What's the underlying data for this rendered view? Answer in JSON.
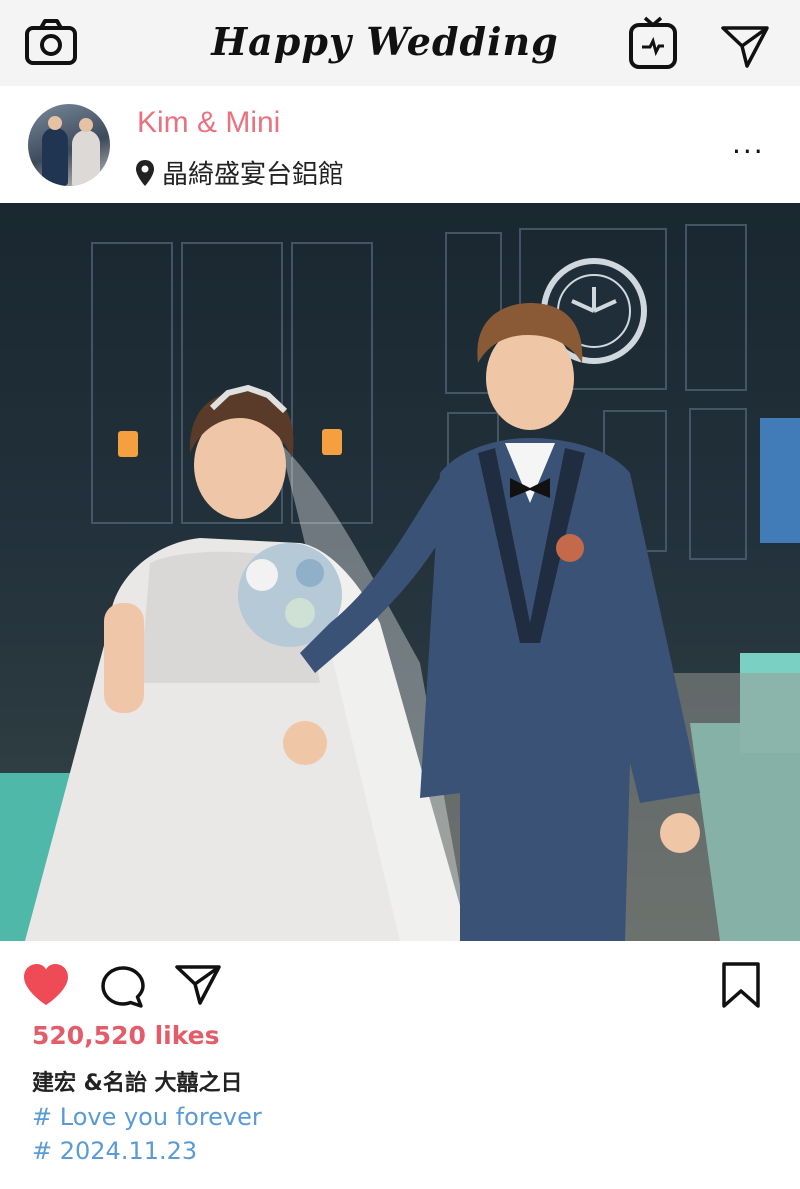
{
  "header": {
    "title": "Happy Wedding",
    "camera_icon": "camera-icon",
    "igtv_icon": "tv-icon",
    "send_icon": "paper-plane-icon"
  },
  "post": {
    "username": "Kim & Mini",
    "location": "晶綺盛宴台鋁館",
    "more_label": "...",
    "photo_alt": "bride and groom walking down aisle",
    "likes": "520,520 likes",
    "caption": "建宏 &名詒 大囍之日",
    "hashtags": [
      "# Love you forever",
      "# 2024.11.23"
    ]
  },
  "colors": {
    "accent": "#e8727f",
    "likes": "#e35c6a",
    "hashtag": "#5b9bd5",
    "heart": "#ef4b57"
  }
}
